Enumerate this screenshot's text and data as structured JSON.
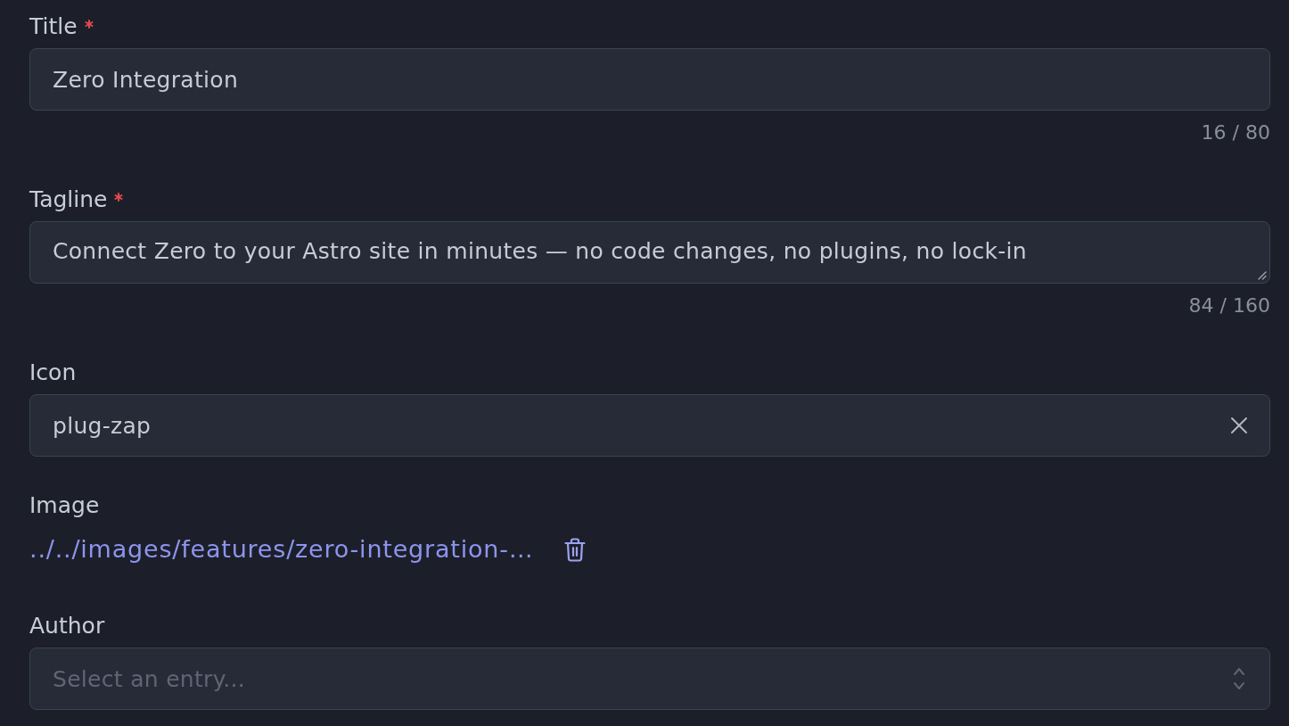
{
  "fields": [
    {
      "kind": "text",
      "label": "Title",
      "required": true,
      "value": "Zero Integration",
      "counter": "16 / 80"
    },
    {
      "kind": "textarea",
      "label": "Tagline",
      "required": true,
      "value": "Connect Zero to your Astro site in minutes — no code changes, no plugins, no lock-in",
      "counter": "84 / 160"
    },
    {
      "kind": "combobox",
      "label": "Icon",
      "required": false,
      "value": "plug-zap",
      "clearable": true
    },
    {
      "kind": "image",
      "label": "Image",
      "required": false,
      "path": "../../images/features/zero-integration-…"
    },
    {
      "kind": "select",
      "label": "Author",
      "required": false,
      "placeholder": "Select an entry..."
    }
  ]
}
